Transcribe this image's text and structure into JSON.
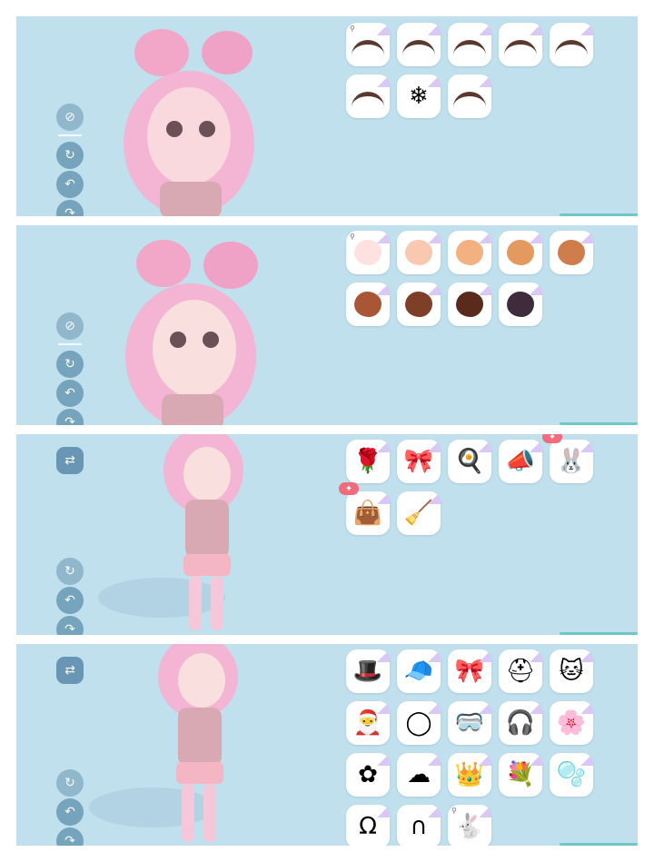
{
  "panels": [
    {
      "id": "eyebrows",
      "rail_icons": [
        "hide-icon",
        "redo-icon",
        "undo-icon",
        "reset-icon"
      ],
      "items": [
        {
          "name": "eyebrow-style-1",
          "kind": "brow",
          "color": "#5a3a30",
          "search": true
        },
        {
          "name": "eyebrow-style-2",
          "kind": "brow",
          "color": "#5a3a30"
        },
        {
          "name": "eyebrow-style-3",
          "kind": "brow",
          "color": "#5a3a30"
        },
        {
          "name": "eyebrow-style-4",
          "kind": "brow",
          "color": "#5a3a30"
        },
        {
          "name": "eyebrow-style-5",
          "kind": "brow",
          "color": "#5a3a30"
        },
        {
          "name": "eyebrow-style-6",
          "kind": "brow",
          "color": "#5a3a30"
        },
        {
          "name": "snowflake-icon",
          "kind": "glyph",
          "glyph": "❄"
        },
        {
          "name": "eyebrow-style-8",
          "kind": "brow",
          "color": "#5a3a30"
        }
      ]
    },
    {
      "id": "skin-tone",
      "rail_icons": [
        "hide-icon",
        "redo-icon",
        "undo-icon",
        "reset-icon"
      ],
      "items": [
        {
          "name": "skin-tone-1",
          "kind": "blob",
          "color": "#fde2e1",
          "search": true
        },
        {
          "name": "skin-tone-2",
          "kind": "blob",
          "color": "#f8c9b0"
        },
        {
          "name": "skin-tone-3",
          "kind": "blob",
          "color": "#f3b081"
        },
        {
          "name": "skin-tone-4",
          "kind": "blob",
          "color": "#e49a5f"
        },
        {
          "name": "skin-tone-5",
          "kind": "blob",
          "color": "#cf7d4a"
        },
        {
          "name": "skin-tone-6",
          "kind": "blob",
          "color": "#a95536"
        },
        {
          "name": "skin-tone-7",
          "kind": "blob",
          "color": "#7d3f28"
        },
        {
          "name": "skin-tone-8",
          "kind": "blob",
          "color": "#5a2a1c"
        },
        {
          "name": "skin-tone-9",
          "kind": "blob",
          "color": "#3e2b3b"
        }
      ]
    },
    {
      "id": "hand-items",
      "rail_icons": [
        "outfit-icon",
        "redo-icon",
        "undo-icon",
        "reset-icon"
      ],
      "items": [
        {
          "name": "rose-item-icon",
          "kind": "glyph",
          "glyph": "🌹"
        },
        {
          "name": "lace-item-icon",
          "kind": "glyph",
          "glyph": "🎀"
        },
        {
          "name": "frying-pan-icon",
          "kind": "glyph",
          "glyph": "🍳"
        },
        {
          "name": "megaphone-icon",
          "kind": "glyph",
          "glyph": "📣"
        },
        {
          "name": "bunny-plush-icon",
          "kind": "glyph",
          "glyph": "🐰",
          "new": true
        },
        {
          "name": "purple-bag-icon",
          "kind": "glyph",
          "glyph": "👜",
          "new": true
        },
        {
          "name": "broom-icon",
          "kind": "glyph",
          "glyph": "🧹"
        }
      ]
    },
    {
      "id": "headwear",
      "rail_icons": [
        "outfit-icon",
        "redo-icon",
        "undo-icon",
        "reset-icon"
      ],
      "items": [
        {
          "name": "white-fedora-icon",
          "kind": "glyph",
          "glyph": "🎩"
        },
        {
          "name": "black-cap-icon",
          "kind": "glyph",
          "glyph": "🧢"
        },
        {
          "name": "bow-icon",
          "kind": "glyph",
          "glyph": "🎀"
        },
        {
          "name": "goggles-helmet-icon",
          "kind": "glyph",
          "glyph": "⛑"
        },
        {
          "name": "cat-ears-icon",
          "kind": "glyph",
          "glyph": "🐱"
        },
        {
          "name": "santa-hat-icon",
          "kind": "glyph",
          "glyph": "🎅"
        },
        {
          "name": "halo-icon",
          "kind": "glyph",
          "glyph": "◯"
        },
        {
          "name": "goggles-icon",
          "kind": "glyph",
          "glyph": "🥽"
        },
        {
          "name": "headphones-icon",
          "kind": "glyph",
          "glyph": "🎧"
        },
        {
          "name": "pink-clips-icon",
          "kind": "glyph",
          "glyph": "🌸"
        },
        {
          "name": "flower-clips-icon",
          "kind": "glyph",
          "glyph": "✿"
        },
        {
          "name": "cloud-hood-icon",
          "kind": "glyph",
          "glyph": "☁"
        },
        {
          "name": "princess-headdress-icon",
          "kind": "glyph",
          "glyph": "👑"
        },
        {
          "name": "flower-crown-icon",
          "kind": "glyph",
          "glyph": "💐"
        },
        {
          "name": "bubble-helmet-icon",
          "kind": "glyph",
          "glyph": "🫧"
        },
        {
          "name": "white-headband-icon",
          "kind": "glyph",
          "glyph": "Ω"
        },
        {
          "name": "earmuffs-icon",
          "kind": "glyph",
          "glyph": "∩"
        },
        {
          "name": "bunny-ears-icon",
          "kind": "glyph",
          "glyph": "🐇",
          "search": true
        }
      ]
    }
  ]
}
